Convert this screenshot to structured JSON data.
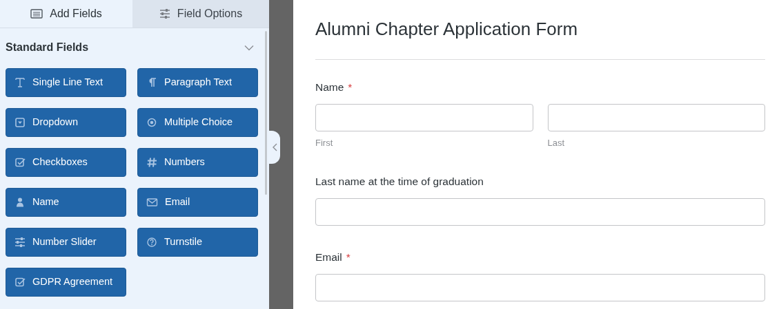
{
  "tabs": [
    {
      "label": "Add Fields",
      "selected": true
    },
    {
      "label": "Field Options",
      "selected": false
    }
  ],
  "section": {
    "title": "Standard Fields",
    "expanded": true
  },
  "field_buttons": [
    {
      "label": "Single Line Text",
      "kind": "text"
    },
    {
      "label": "Paragraph Text",
      "kind": "paragraph"
    },
    {
      "label": "Dropdown",
      "kind": "dropdown"
    },
    {
      "label": "Multiple Choice",
      "kind": "radio"
    },
    {
      "label": "Checkboxes",
      "kind": "checkbox"
    },
    {
      "label": "Numbers",
      "kind": "number"
    },
    {
      "label": "Name",
      "kind": "name"
    },
    {
      "label": "Email",
      "kind": "email"
    },
    {
      "label": "Number Slider",
      "kind": "slider"
    },
    {
      "label": "Turnstile",
      "kind": "captcha"
    },
    {
      "label": "GDPR Agreement",
      "kind": "checkbox"
    }
  ],
  "form": {
    "title": "Alumni Chapter Application Form",
    "fields": [
      {
        "label": "Name",
        "required_mark": "*",
        "sublabels": [
          "First",
          "Last"
        ]
      },
      {
        "label": "Last name at the time of graduation"
      },
      {
        "label": "Email",
        "required_mark": "*"
      }
    ]
  }
}
